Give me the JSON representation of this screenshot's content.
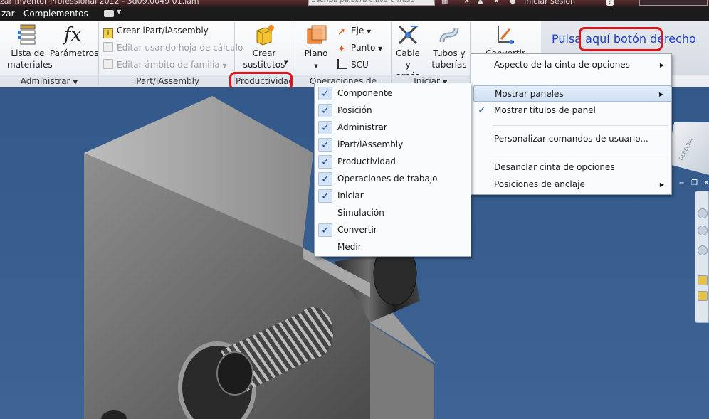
{
  "titlebar": {
    "title": "zar Inventor Professional 2012 - 3d09.0049 01.iam",
    "search_placeholder": "Escriba palabra clave o frase",
    "login": "Iniciar sesión",
    "help": "?"
  },
  "menubar": {
    "items": [
      "zar",
      "Complementos"
    ]
  },
  "ribbon": {
    "administrar": {
      "title": "Administrar",
      "lista": [
        "Lista de",
        "materiales"
      ],
      "parametros": "Parámetros",
      "fx": "fx"
    },
    "ipart": {
      "title": "iPart/iAssembly",
      "crear": "Crear iPart/iAssembly",
      "editar_hoja": "Editar usando hoja de cálculo",
      "editar_ambito": "Editar ámbito de familia"
    },
    "productividad": {
      "title": "Productividad",
      "crear": [
        "Crear",
        "sustitutos"
      ]
    },
    "operaciones": {
      "title": "Operaciones de trabajo",
      "plano": "Plano",
      "eje": "Eje",
      "punto": "Punto",
      "scu": "SCU"
    },
    "iniciar": {
      "title": "Iniciar",
      "cable": [
        "Cable y",
        "arnés"
      ],
      "tubos": [
        "Tubos y",
        "tuberías"
      ]
    },
    "convertir": {
      "label": "Convertir"
    },
    "hint": "Pulsa aquí botón derecho"
  },
  "context_menu": {
    "items": [
      {
        "label": "Aspecto de la cinta de opciones",
        "submenu": true,
        "checked": false
      },
      {
        "label": "Mostrar paneles",
        "submenu": true,
        "checked": false,
        "highlighted": true
      },
      {
        "label": "Mostrar títulos de panel",
        "submenu": false,
        "checked": true
      },
      {
        "label": "Personalizar comandos de usuario...",
        "submenu": false,
        "checked": false
      },
      {
        "label": "Desanclar cinta de opciones",
        "submenu": false,
        "checked": false
      },
      {
        "label": "Posiciones de anclaje",
        "submenu": true,
        "checked": false
      }
    ]
  },
  "panels_submenu": {
    "items": [
      {
        "label": "Componente",
        "checked": true
      },
      {
        "label": "Posición",
        "checked": true
      },
      {
        "label": "Administrar",
        "checked": true
      },
      {
        "label": "iPart/iAssembly",
        "checked": true
      },
      {
        "label": "Productividad",
        "checked": true
      },
      {
        "label": "Operaciones de trabajo",
        "checked": true
      },
      {
        "label": "Iniciar",
        "checked": true
      },
      {
        "label": "Simulación",
        "checked": false
      },
      {
        "label": "Convertir",
        "checked": true
      },
      {
        "label": "Medir",
        "checked": false
      }
    ]
  },
  "viewcube": {
    "label": "DERECHA"
  },
  "colors": {
    "accent_red": "#e0151b",
    "hint_blue": "#1d3fd0",
    "viewport_blue": "#3a5f8e"
  }
}
